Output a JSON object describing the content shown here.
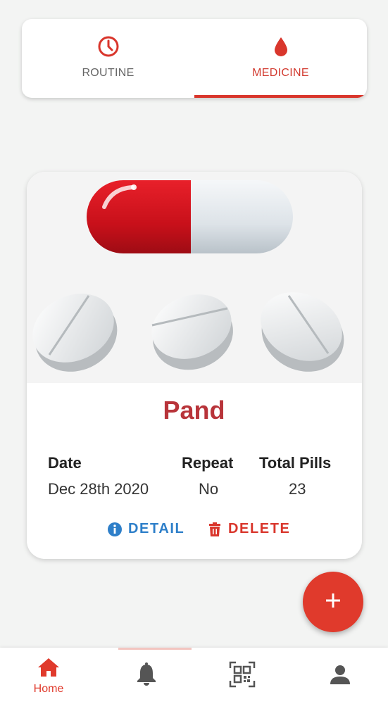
{
  "tabs": [
    {
      "label": "ROUTINE",
      "icon": "clock-icon",
      "active": false
    },
    {
      "label": "MEDICINE",
      "icon": "drop-icon",
      "active": true
    }
  ],
  "medicine": {
    "name": "Pand",
    "headers": {
      "date": "Date",
      "repeat": "Repeat",
      "total": "Total Pills"
    },
    "values": {
      "date": "Dec 28th 2020",
      "repeat": "No",
      "total": "23"
    },
    "detail_label": "DETAIL",
    "delete_label": "DELETE"
  },
  "bottom_nav": {
    "home_label": "Home",
    "items": [
      "home-icon",
      "bell-icon",
      "qr-code-icon",
      "person-icon"
    ]
  },
  "colors": {
    "accent": "#d9362c",
    "name": "#b8343a",
    "detail": "#2e7fc9"
  }
}
